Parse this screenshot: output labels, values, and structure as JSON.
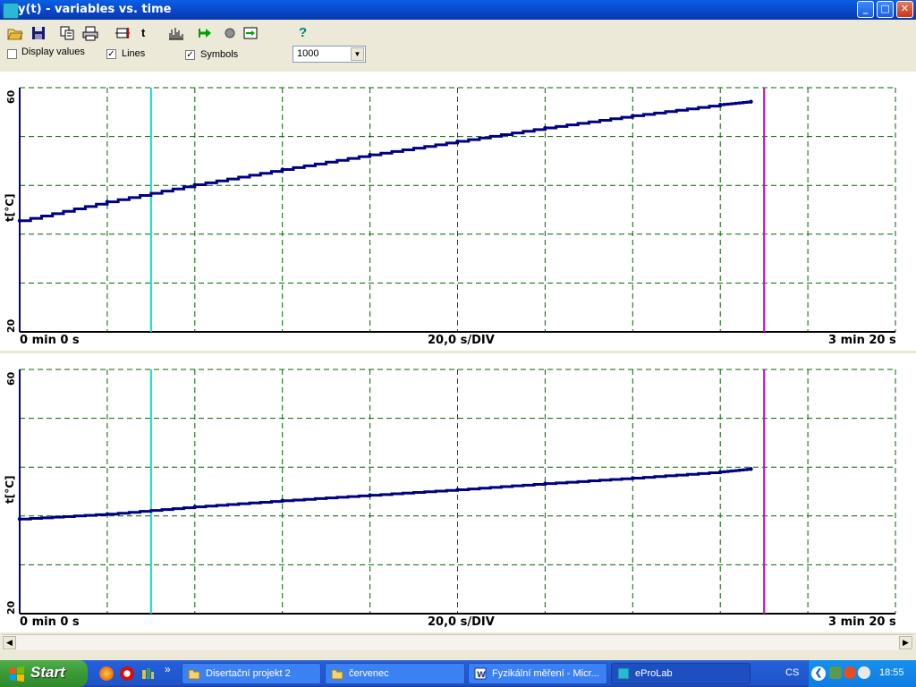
{
  "window": {
    "title": "y(t) - variables vs. time"
  },
  "toolbar": {
    "icons": [
      "open-icon",
      "save-icon",
      "export-icon",
      "print-icon",
      "cursor-range-icon",
      "time-cursor-icon",
      "frequency-icon",
      "run-icon",
      "record-icon",
      "export-data-icon",
      "help-icon"
    ],
    "t_label": "t",
    "help_label": "?"
  },
  "options": {
    "display_values": {
      "label": "Display values",
      "checked": false
    },
    "lines": {
      "label": "Lines",
      "checked": true
    },
    "symbols": {
      "label": "Symbols",
      "checked": true
    },
    "points_select": {
      "value": "1000"
    }
  },
  "plots": [
    {
      "ylabel": "t[°C]",
      "ymax": "60",
      "ymin": "20",
      "xstart": "0 min 0 s",
      "xdiv": "20,0 s/DIV",
      "xend": "3 min 20 s"
    },
    {
      "ylabel": "t[°C]",
      "ymax": "60",
      "ymin": "20",
      "xstart": "0 min 0 s",
      "xdiv": "20,0 s/DIV",
      "xend": "3 min 20 s"
    }
  ],
  "chart_data": [
    {
      "type": "line",
      "xlabel": "",
      "ylabel": "t[°C]",
      "ylim": [
        20,
        60
      ],
      "xlim": [
        0,
        200
      ],
      "x_division_s": 20,
      "grid": true,
      "cursor_cyan_s": 30,
      "cursor_magenta_s": 170,
      "series": [
        {
          "x": [
            0,
            20,
            40,
            60,
            80,
            100,
            120,
            140,
            160,
            167
          ],
          "y": [
            38.2,
            41.3,
            44.1,
            46.6,
            49.0,
            51.2,
            53.4,
            55.4,
            57.2,
            57.7
          ]
        }
      ]
    },
    {
      "type": "line",
      "xlabel": "",
      "ylabel": "t[°C]",
      "ylim": [
        20,
        60
      ],
      "xlim": [
        0,
        200
      ],
      "x_division_s": 20,
      "grid": true,
      "cursor_cyan_s": 30,
      "cursor_magenta_s": 170,
      "series": [
        {
          "x": [
            0,
            20,
            40,
            60,
            80,
            100,
            120,
            140,
            160,
            167
          ],
          "y": [
            35.5,
            36.3,
            37.5,
            38.5,
            39.4,
            40.3,
            41.3,
            42.2,
            43.2,
            43.7
          ]
        }
      ]
    }
  ],
  "colors": {
    "series": "#000080",
    "grid": "#006400",
    "cursor1": "#00e0e0",
    "cursor2": "#d000d0"
  },
  "taskbar": {
    "start_label": "Start",
    "more_label": "»",
    "tasks": [
      {
        "label": "Disertační projekt 2"
      },
      {
        "label": "červenec"
      },
      {
        "label": "Fyzikální měření - Micr..."
      },
      {
        "label": "eProLab"
      }
    ],
    "language": "CS",
    "clock": "18:55"
  }
}
